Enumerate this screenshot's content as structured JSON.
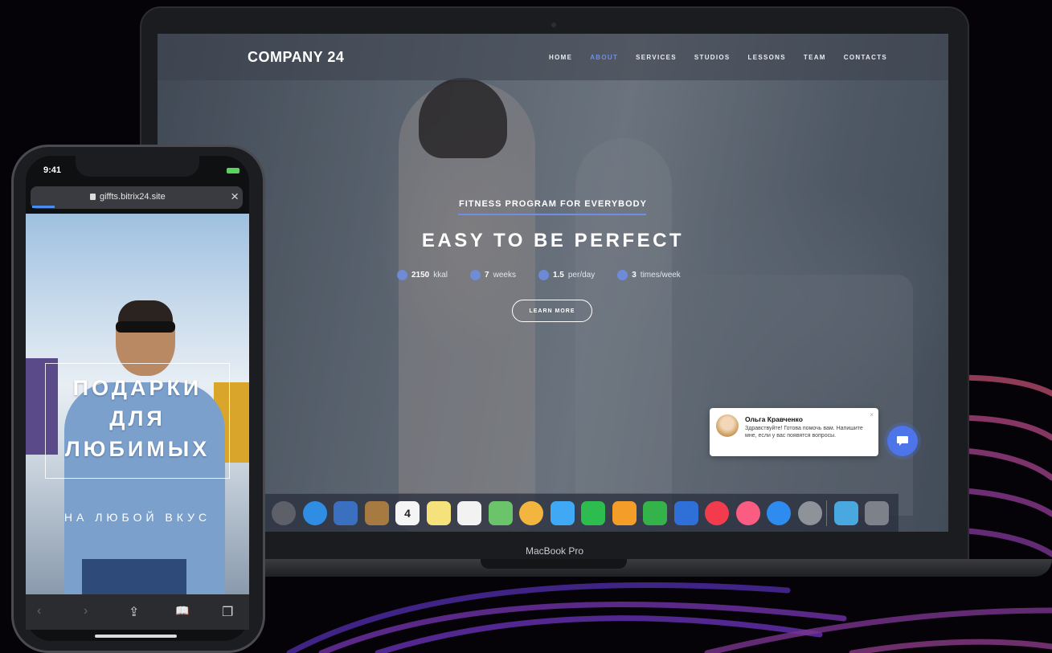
{
  "laptop": {
    "model_label": "MacBook Pro",
    "site": {
      "brand": "COMPANY 24",
      "nav": [
        {
          "label": "HOME",
          "active": false
        },
        {
          "label": "ABOUT",
          "active": true
        },
        {
          "label": "SERVICES",
          "active": false
        },
        {
          "label": "STUDIOS",
          "active": false
        },
        {
          "label": "LESSONS",
          "active": false
        },
        {
          "label": "TEAM",
          "active": false
        },
        {
          "label": "CONTACTS",
          "active": false
        }
      ],
      "hero": {
        "subtitle": "FITNESS PROGRAM FOR EVERYBODY",
        "title": "EASY TO BE PERFECT",
        "stats": [
          {
            "value": "2150",
            "unit": "kkal"
          },
          {
            "value": "7",
            "unit": "weeks"
          },
          {
            "value": "1.5",
            "unit": "per/day"
          },
          {
            "value": "3",
            "unit": "times/week"
          }
        ],
        "cta": "LEARN MORE"
      },
      "chat": {
        "name": "Ольга Кравченко",
        "message": "Здравствуйте! Готова помочь вам. Напишите мне, если у вас появятся вопросы.",
        "close": "×"
      }
    },
    "dock": [
      {
        "icon": "launchpad-icon",
        "color": "#5d6068"
      },
      {
        "icon": "safari-icon",
        "color": "#2f8de4"
      },
      {
        "icon": "preview-icon",
        "color": "#3b6fbf"
      },
      {
        "icon": "contacts-icon",
        "color": "#a77a42"
      },
      {
        "icon": "calendar-icon",
        "color": "#f5f5f5",
        "text": "4"
      },
      {
        "icon": "notes-icon",
        "color": "#f6e27a"
      },
      {
        "icon": "reminders-icon",
        "color": "#f2f2f2"
      },
      {
        "icon": "maps-icon",
        "color": "#6cc46a"
      },
      {
        "icon": "photos-icon",
        "color": "#f4b53f"
      },
      {
        "icon": "messages-icon",
        "color": "#3fa9f5"
      },
      {
        "icon": "facetime-icon",
        "color": "#2dbd4f"
      },
      {
        "icon": "pages-icon",
        "color": "#f59d29"
      },
      {
        "icon": "numbers-icon",
        "color": "#34b34a"
      },
      {
        "icon": "keynote-icon",
        "color": "#2e6fd8"
      },
      {
        "icon": "news-icon",
        "color": "#f23c4e"
      },
      {
        "icon": "music-icon",
        "color": "#fa5c82"
      },
      {
        "icon": "app-store-icon",
        "color": "#2e8cf0"
      },
      {
        "icon": "system-preferences-icon",
        "color": "#8e9299"
      },
      {
        "icon": "downloads-folder-icon",
        "color": "#4aa8e0"
      },
      {
        "icon": "trash-icon",
        "color": "#7d828a"
      }
    ]
  },
  "phone": {
    "time": "9:41",
    "url": "giffts.bitrix24.site",
    "close": "×",
    "page": {
      "title_lines": [
        "ПОДАРКИ",
        "ДЛЯ",
        "ЛЮБИМЫХ"
      ],
      "subtitle": "НА ЛЮБОЙ ВКУС"
    },
    "toolbar": [
      {
        "icon": "back-icon",
        "glyph": "‹",
        "enabled": false
      },
      {
        "icon": "forward-icon",
        "glyph": "›",
        "enabled": false
      },
      {
        "icon": "share-icon",
        "glyph": "⇪",
        "enabled": true
      },
      {
        "icon": "bookmarks-icon",
        "glyph": "📖",
        "enabled": true
      },
      {
        "icon": "tabs-icon",
        "glyph": "❐",
        "enabled": true
      }
    ]
  }
}
